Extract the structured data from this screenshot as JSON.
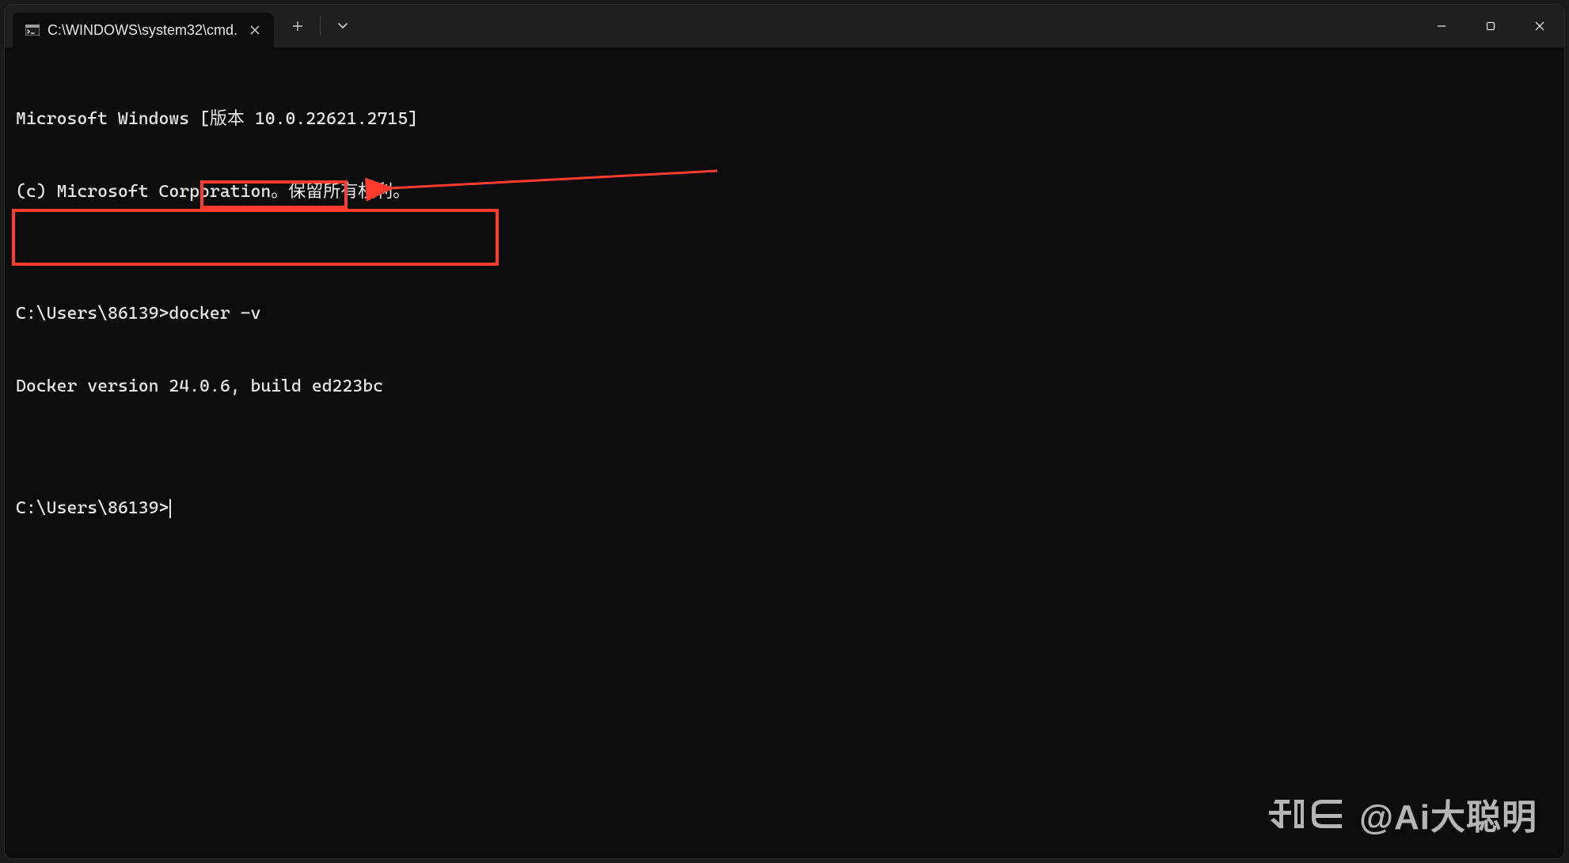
{
  "titlebar": {
    "tab_title": "C:\\WINDOWS\\system32\\cmd.",
    "new_tab_glyph": "+",
    "dropdown_glyph": "⌄",
    "close_glyph": "✕"
  },
  "terminal": {
    "line1": "Microsoft Windows [版本 10.0.22621.2715]",
    "line2": "(c) Microsoft Corporation。保留所有权利。",
    "blank": "",
    "prompt1_prefix": "C:\\Users\\86139>",
    "command1": "docker -v",
    "output1": "Docker version 24.0.6, build ed223bc",
    "prompt2": "C:\\Users\\86139>"
  },
  "watermark": {
    "text": "@Ai大聪明"
  },
  "annotations": {
    "highlight_color": "#ff3b30"
  }
}
